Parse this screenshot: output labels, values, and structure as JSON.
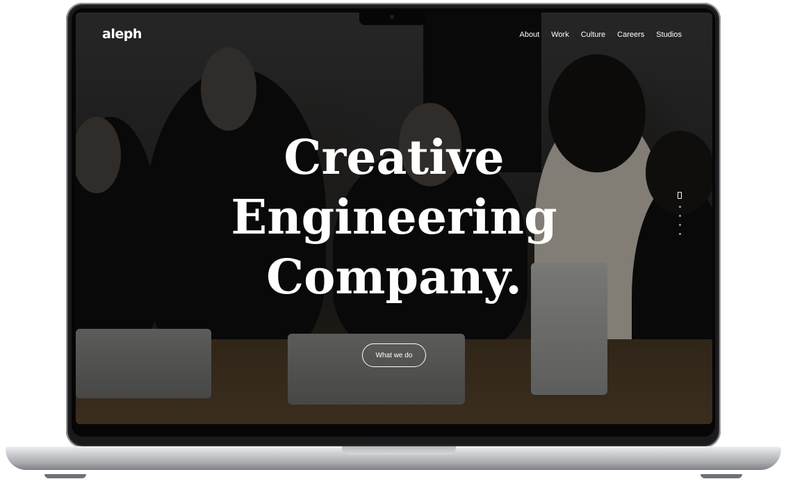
{
  "site": {
    "logo": "aleph",
    "nav": [
      "About",
      "Work",
      "Culture",
      "Careers",
      "Studios"
    ]
  },
  "hero": {
    "title_lines": [
      "Creative",
      "Engineering",
      "Company."
    ],
    "cta_label": "What we do",
    "slide_indicator": {
      "total": 5,
      "active_index": 0
    }
  },
  "colors": {
    "text": "#ffffff",
    "laptop_frame": "#1a1a1c",
    "laptop_base": "#c9cbce"
  },
  "icons": [
    "camera-icon",
    "slide-indicator-dot"
  ]
}
